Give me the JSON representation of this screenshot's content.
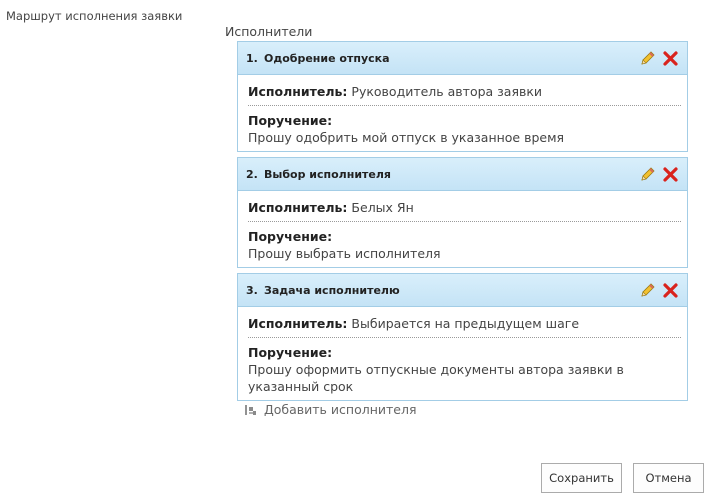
{
  "route_label": "Маршрут исполнения заявки",
  "executors_title": "Исполнители",
  "labels": {
    "executor": "Исполнитель:",
    "assignment": "Поручение:"
  },
  "steps": [
    {
      "number": "1.",
      "title": "Одобрение отпуска",
      "executor": "Руководитель автора заявки",
      "assignment": "Прошу одобрить мой отпуск в указанное время"
    },
    {
      "number": "2.",
      "title": "Выбор исполнителя",
      "executor": "Белых Ян",
      "assignment": "Прошу выбрать исполнителя"
    },
    {
      "number": "3.",
      "title": "Задача исполнителю",
      "executor": "Выбирается на предыдущем шаге",
      "assignment": "Прошу оформить отпускные документы автора заявки в указанный срок"
    }
  ],
  "icons": {
    "edit": "pencil-icon",
    "delete": "close-icon",
    "add": "add-executor-icon"
  },
  "add_executor_label": "Добавить исполнителя",
  "buttons": {
    "save": "Сохранить",
    "cancel": "Отмена"
  },
  "colors": {
    "header_bg": "#cfe9f8",
    "border": "#a3cde6",
    "delete_red": "#d9231d",
    "pencil_yellow": "#f2c12e"
  }
}
